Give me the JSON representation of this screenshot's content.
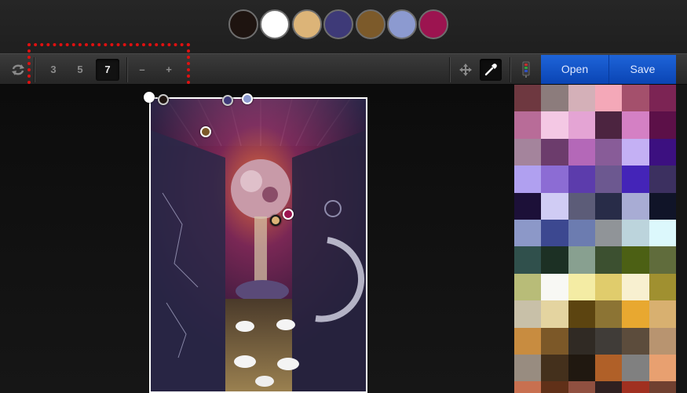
{
  "palette": {
    "swatches": [
      "#1e1410",
      "#ffffff",
      "#dcb478",
      "#3e3a78",
      "#7c5a2a",
      "#8c9ad0",
      "#9c1450"
    ]
  },
  "toolbar": {
    "sizes": [
      "3",
      "5",
      "7"
    ],
    "active_size": "7",
    "minus_label": "–",
    "plus_label": "+",
    "open_label": "Open",
    "save_label": "Save"
  },
  "colors": {
    "accent_blue": "#0f55d2",
    "highlight_red": "#e01010"
  },
  "picker_markers": [
    "#ffffff",
    "#1e1410",
    "#3e3a78",
    "#8c9ad0",
    "#7c5a2a",
    "#9c1450",
    "#dcb478"
  ],
  "grid_colors": [
    "#6e3840",
    "#8c7c7c",
    "#d4b0b8",
    "#f4a8b8",
    "#a4506c",
    "#7c2454",
    "#b86c98",
    "#f4c8e4",
    "#e4a4d4",
    "#4c2440",
    "#d480c4",
    "#5c1048",
    "#a4849c",
    "#6c3c6c",
    "#b468b8",
    "#885c98",
    "#c4b0f4",
    "#3c1080",
    "#b0a0f0",
    "#8c6cd4",
    "#5c3cac",
    "#6c5890",
    "#4424b8",
    "#3c3060",
    "#1c1038",
    "#d0ccf4",
    "#5c5c78",
    "#282c48",
    "#a8acd4",
    "#101428",
    "#8c98c8",
    "#3c4890",
    "#6c7cb0",
    "#909498",
    "#bcd4dc",
    "#dcf8fc",
    "#30504c",
    "#1c3024",
    "#88a090",
    "#3c5030",
    "#4c6014",
    "#606c3c",
    "#b8bc78",
    "#f8f8f4",
    "#f4eca4",
    "#e0cc6c",
    "#f8f0d0",
    "#a09030",
    "#c8c0a8",
    "#e4d4a0",
    "#5c4410",
    "#8c7434",
    "#e8a830",
    "#d8b070",
    "#c88c40",
    "#7c5828",
    "#302a24",
    "#403c38",
    "#5c4c3c",
    "#b89470",
    "#988c80",
    "#44301c",
    "#201810",
    "#b06028",
    "#808080",
    "#e8a070",
    "#c87050",
    "#603018",
    "#905040",
    "#302020",
    "#a03020",
    "#704030"
  ]
}
